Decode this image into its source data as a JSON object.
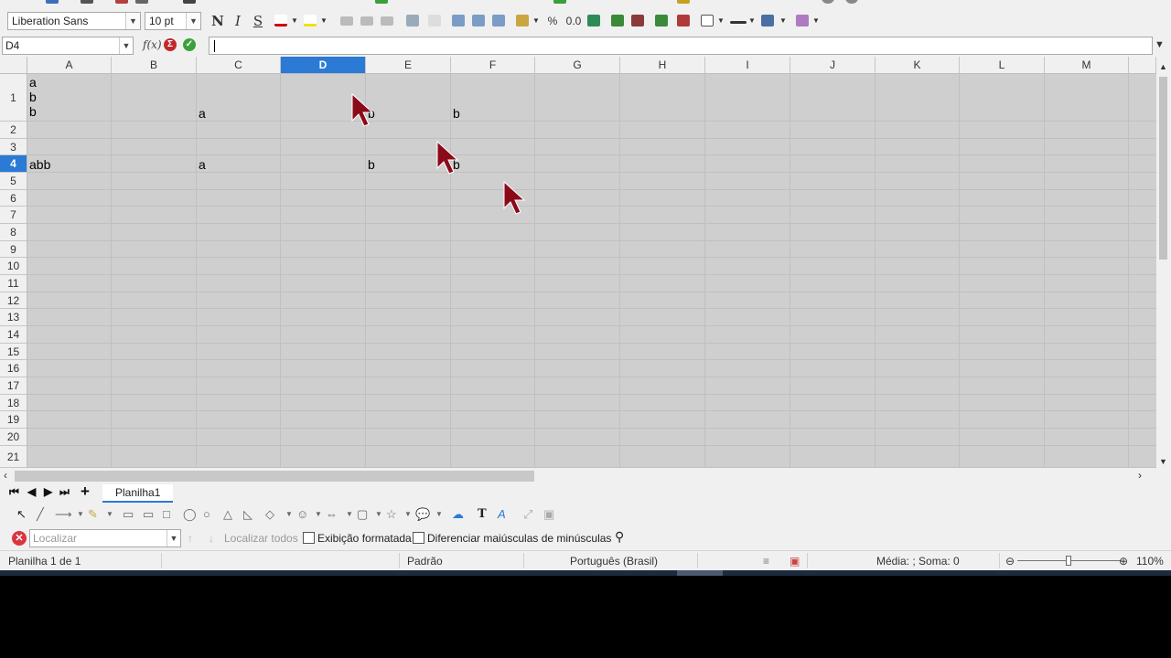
{
  "toolbar": {
    "font_name": "Liberation Sans",
    "font_size": "10 pt",
    "bold_label": "N",
    "italic_label": "I",
    "underline_label": "S",
    "percent_label": "%",
    "decimal_label": "0.0"
  },
  "formula_bar": {
    "name_box": "D4",
    "fx_label": "f(x)",
    "content": ""
  },
  "grid": {
    "columns": [
      "A",
      "B",
      "C",
      "D",
      "E",
      "F",
      "G",
      "H",
      "I",
      "J",
      "K",
      "L",
      "M"
    ],
    "selected_column": "D",
    "rows": [
      "1",
      "2",
      "3",
      "4",
      "5",
      "6",
      "7",
      "8",
      "9",
      "10",
      "11",
      "12",
      "13",
      "14",
      "15",
      "16",
      "17",
      "18",
      "19",
      "20",
      "21"
    ],
    "selected_row": "4",
    "cells": {
      "A1": "a\nb\nb",
      "C1": "a",
      "E1": "b",
      "F1": "b",
      "A4": "abb",
      "C4": "a",
      "E4": "b",
      "F4": "b"
    }
  },
  "sheets": {
    "tabs": [
      "Planilha1"
    ],
    "active": "Planilha1",
    "add_label": "+"
  },
  "find_bar": {
    "placeholder": "Localizar",
    "find_all": "Localizar todos",
    "formatted_display": "Exibição formatada",
    "match_case": "Diferenciar maiúsculas de minúsculas"
  },
  "status_bar": {
    "sheet_info": "Planilha 1 de 1",
    "page_style": "Padrão",
    "language": "Português (Brasil)",
    "sum_info": "Média: ; Soma: 0",
    "zoom": "110%"
  },
  "colors": {
    "selection": "#2a7ad6",
    "cursor": "#8b0a1a",
    "sheet_bg": "#cfcfcf"
  }
}
